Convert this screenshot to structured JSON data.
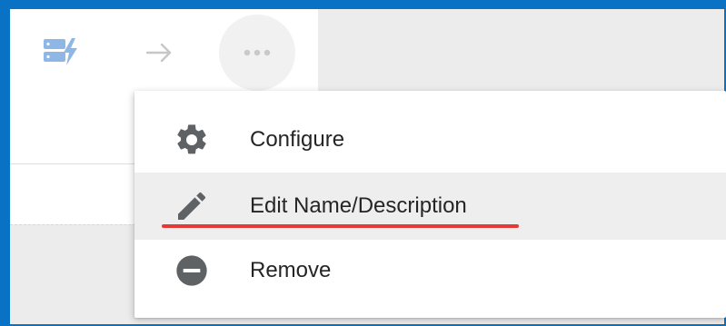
{
  "toolbar": {
    "server_icon": "server-stack-lightning-icon",
    "arrow_icon": "arrow-right-icon",
    "more_icon": "more-horizontal-icon"
  },
  "menu": {
    "items": [
      {
        "label": "Configure",
        "icon": "gear-icon"
      },
      {
        "label": "Edit Name/Description",
        "icon": "pencil-icon",
        "highlighted": true
      },
      {
        "label": "Remove",
        "icon": "minus-circle-icon"
      }
    ]
  },
  "colors": {
    "outer_border": "#0a72c4",
    "background": "#ececec",
    "card": "#ffffff",
    "menu_highlight": "#eeeeee",
    "icon_dark": "#5f6265",
    "icon_light": "#8fb7e6",
    "arrow_light": "#c7c7c7",
    "annotation_underline": "#e53935"
  }
}
